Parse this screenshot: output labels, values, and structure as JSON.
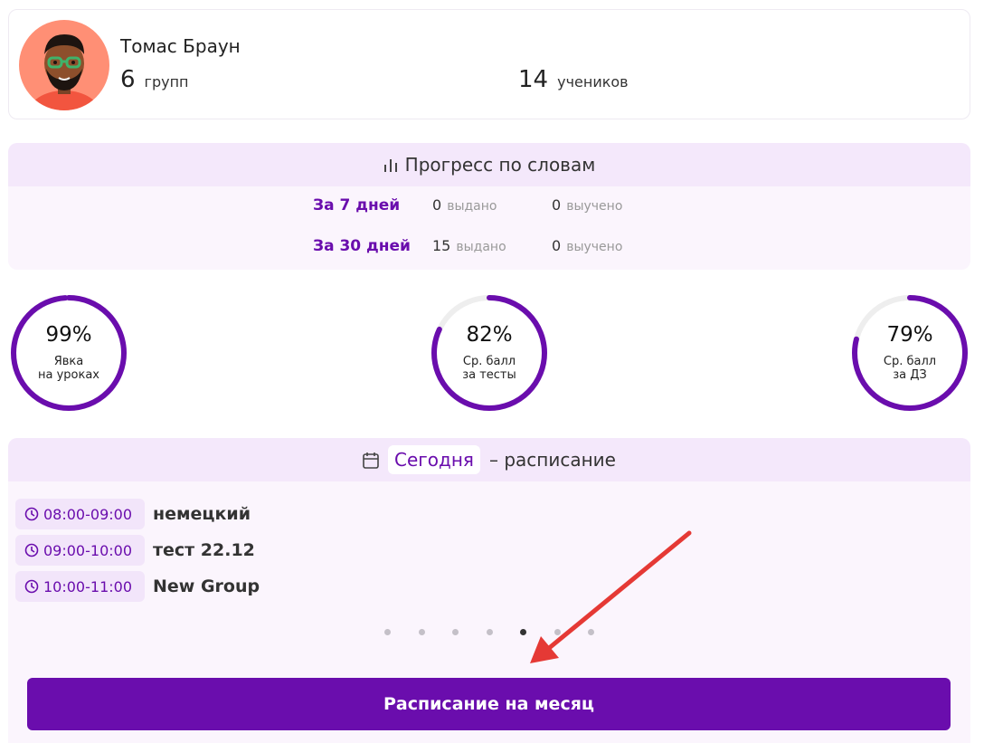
{
  "profile": {
    "name": "Томас Браун",
    "groups_count": "6",
    "groups_label": "групп",
    "students_count": "14",
    "students_label": "учеников"
  },
  "progress": {
    "title": "Прогресс по словам",
    "rows": [
      {
        "period": "За 7 дней",
        "issued": "0",
        "issued_label": "выдано",
        "learned": "0",
        "learned_label": "выучено"
      },
      {
        "period": "За 30 дней",
        "issued": "15",
        "issued_label": "выдано",
        "learned": "0",
        "learned_label": "выучено"
      }
    ]
  },
  "stats": [
    {
      "percent": "99%",
      "value": 0.99,
      "caption_line1": "Явка",
      "caption_line2": "на уроках"
    },
    {
      "percent": "82%",
      "value": 0.82,
      "caption_line1": "Ср. балл",
      "caption_line2": "за тесты"
    },
    {
      "percent": "79%",
      "value": 0.79,
      "caption_line1": "Ср. балл",
      "caption_line2": "за ДЗ"
    }
  ],
  "schedule": {
    "today_label": "Сегодня",
    "title_suffix": "– расписание",
    "lessons": [
      {
        "time": "08:00-09:00",
        "name": "немецкий"
      },
      {
        "time": "09:00-10:00",
        "name": "тест 22.12"
      },
      {
        "time": "10:00-11:00",
        "name": "New Group"
      }
    ],
    "pagination_total": 7,
    "pagination_active": 5,
    "month_button": "Расписание на месяц"
  },
  "colors": {
    "accent": "#6a0dad",
    "ring_track": "#eeeeee",
    "header_bg": "#f4e8fb",
    "panel_bg": "#fbf5fd",
    "avatar_bg": "#ff8f75",
    "annotation_arrow": "#e53935"
  },
  "icons": {
    "progress": "bar-chart-icon",
    "schedule": "calendar-icon",
    "time": "clock-icon"
  }
}
